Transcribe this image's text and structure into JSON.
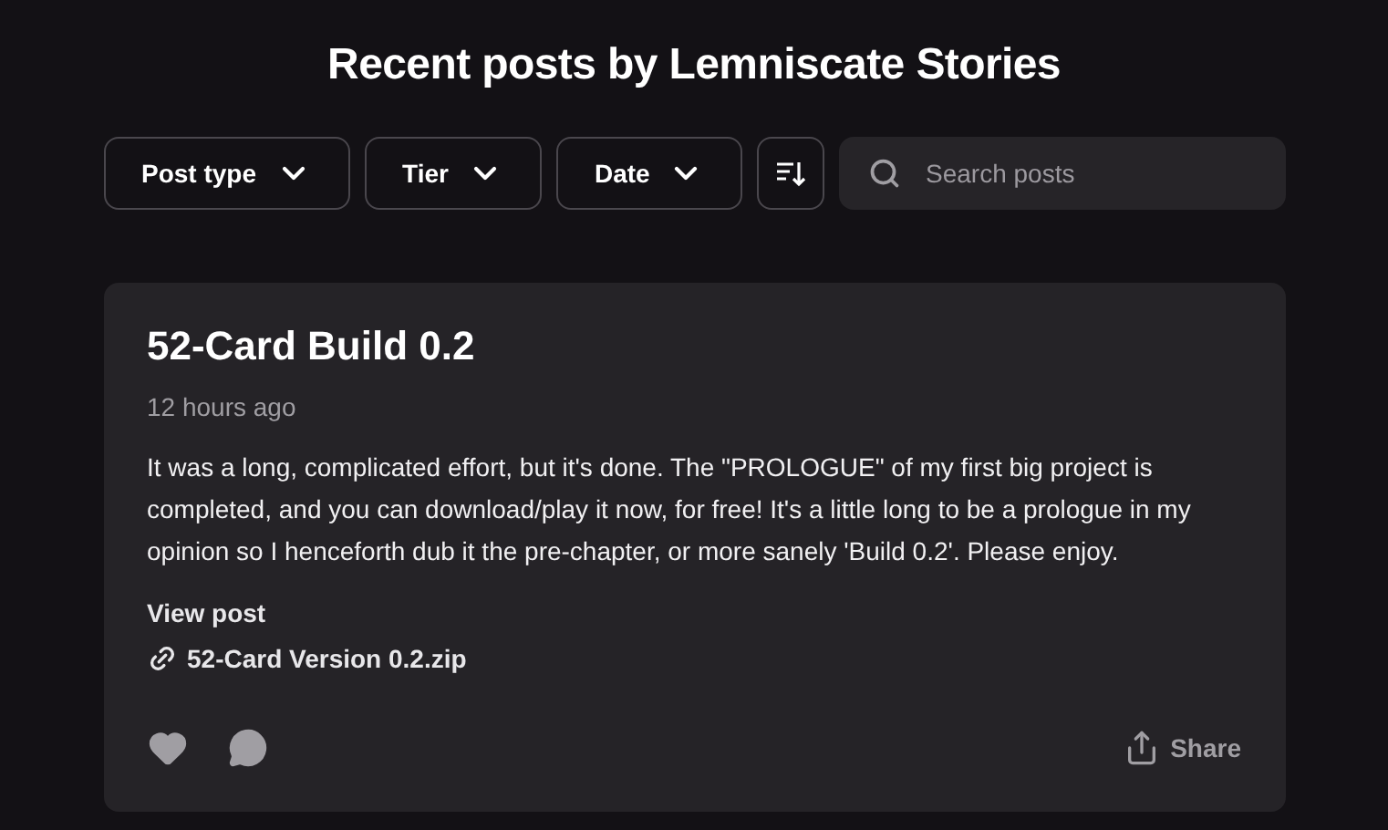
{
  "heading": "Recent posts by Lemniscate Stories",
  "filters": [
    {
      "label": "Post type"
    },
    {
      "label": "Tier"
    },
    {
      "label": "Date"
    }
  ],
  "search": {
    "placeholder": "Search posts"
  },
  "post": {
    "title": "52-Card Build 0.2",
    "time": "12 hours ago",
    "body": "It was a long, complicated effort, but it's done. The \"PROLOGUE\" of my first big project is completed, and you can download/play it now, for free! It's a little long to be a prologue in my opinion so I henceforth dub it the pre-chapter, or more sanely 'Build 0.2'. Please enjoy.",
    "view_link": "View post",
    "attachment": "52-Card Version 0.2.zip",
    "share": "Share"
  }
}
